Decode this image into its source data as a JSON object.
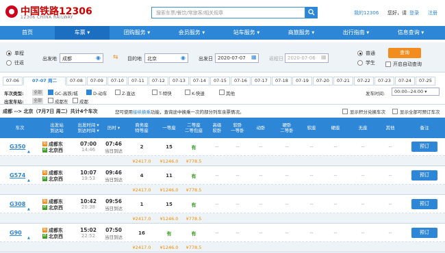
{
  "header": {
    "brand": "中国铁路12306",
    "brand_sub": "12306 CHINA RAILWAY",
    "search_placeholder": "搜索车票/餐饮/常旅客/相关规章",
    "my_link": "我的12306",
    "greeting": "您好，请",
    "login": "登录",
    "register": "注册"
  },
  "nav": [
    {
      "label": "首页"
    },
    {
      "label": "车票 ▾"
    },
    {
      "label": "团购服务 ▾"
    },
    {
      "label": "会员服务 ▾"
    },
    {
      "label": "站车服务 ▾"
    },
    {
      "label": "商旅服务 ▾"
    },
    {
      "label": "出行指南 ▾"
    },
    {
      "label": "信息查询 ▾"
    }
  ],
  "form": {
    "one_way": "单程",
    "round_trip": "往返",
    "from_label": "出发地",
    "from_value": "成都",
    "to_label": "目的地",
    "to_value": "北京",
    "date_label": "出发日",
    "date_value": "2020-07-07",
    "return_label": "返程日",
    "return_value": "2020-07-06",
    "normal": "普通",
    "student": "学生",
    "query": "查询",
    "auto_query": "开启自动查询"
  },
  "date_tabs": [
    "07-06",
    "07-07 周二",
    "07-08",
    "07-09",
    "07-10",
    "07-11",
    "07-12",
    "07-13",
    "07-14",
    "07-15",
    "07-16",
    "07-17",
    "07-18",
    "07-19",
    "07-20",
    "07-21",
    "07-22",
    "07-23",
    "07-24",
    "07-25"
  ],
  "filters": {
    "type_label": "车次类型:",
    "all1": "全部",
    "types": [
      "GC-高铁/城",
      "D-动车",
      "Z-直达",
      "T-特快",
      "K-快速",
      "其他"
    ],
    "depart_time_label": "发车时间:",
    "depart_time_value": "00:00--24:00 ▾",
    "station_label": "出发车站:",
    "all2": "全部",
    "stations": [
      "成都东",
      "成都"
    ]
  },
  "summary": {
    "route": "成都 --> 北京（7月7日  周二）共计4个车次",
    "tip_pre": "您可使用",
    "tip_link": "接续换乘",
    "tip_post": "功能，查询途中换乘一次的部分列车余票情况。",
    "opt1": "显示积分兑换车次",
    "opt2": "显示全部可预订车次"
  },
  "columns": [
    {
      "l1": "车次",
      "l2": ""
    },
    {
      "l1": "出发站",
      "l2": "到达站"
    },
    {
      "l1": "出发时间 ▾",
      "l2": "到达时间 ▾"
    },
    {
      "l1": "历时 ▾",
      "l2": ""
    },
    {
      "l1": "商务座",
      "l2": "特等座"
    },
    {
      "l1": "一等座",
      "l2": ""
    },
    {
      "l1": "二等座",
      "l2": "二等包座"
    },
    {
      "l1": "高级",
      "l2": "软卧"
    },
    {
      "l1": "软卧",
      "l2": "一等卧"
    },
    {
      "l1": "动卧",
      "l2": ""
    },
    {
      "l1": "硬卧",
      "l2": "二等卧"
    },
    {
      "l1": "软座",
      "l2": ""
    },
    {
      "l1": "硬座",
      "l2": ""
    },
    {
      "l1": "无座",
      "l2": ""
    },
    {
      "l1": "其他",
      "l2": ""
    },
    {
      "l1": "备注",
      "l2": ""
    }
  ],
  "trains": [
    {
      "no": "G350",
      "from": "成都东",
      "to": "北京西",
      "dep": "07:00",
      "arr": "14:46",
      "dur": "07:46",
      "day": "当日到达",
      "biz": "2",
      "first": "15",
      "second": "有",
      "price_biz": "¥2417.0",
      "price_first": "¥1246.0",
      "price_second": "¥778.5"
    },
    {
      "no": "G574",
      "from": "成都东",
      "to": "北京西",
      "dep": "10:07",
      "arr": "19:53",
      "dur": "09:46",
      "day": "当日到达",
      "biz": "4",
      "first": "11",
      "second": "有",
      "price_biz": "¥2417.0",
      "price_first": "¥1246.0",
      "price_second": "¥778.5"
    },
    {
      "no": "G308",
      "from": "成都东",
      "to": "北京西",
      "dep": "10:42",
      "arr": "20:38",
      "dur": "09:56",
      "day": "当日到达",
      "biz": "1",
      "first": "15",
      "second": "有",
      "price_biz": "¥2417.0",
      "price_first": "¥1246.0",
      "price_second": "¥778.5"
    },
    {
      "no": "G90",
      "from": "成都东",
      "to": "北京西",
      "dep": "15:02",
      "arr": "22:52",
      "dur": "07:50",
      "day": "当日到达",
      "biz": "16",
      "first": "有",
      "second": "有",
      "price_biz": "¥2417.0",
      "price_first": "¥1246.0",
      "price_second": "¥778.5"
    }
  ],
  "dash": "--",
  "book_label": "预订",
  "colors": {
    "primary": "#2e86d6",
    "orange": "#f28c1e",
    "green": "#3a9d23",
    "brand_red": "#c00"
  }
}
